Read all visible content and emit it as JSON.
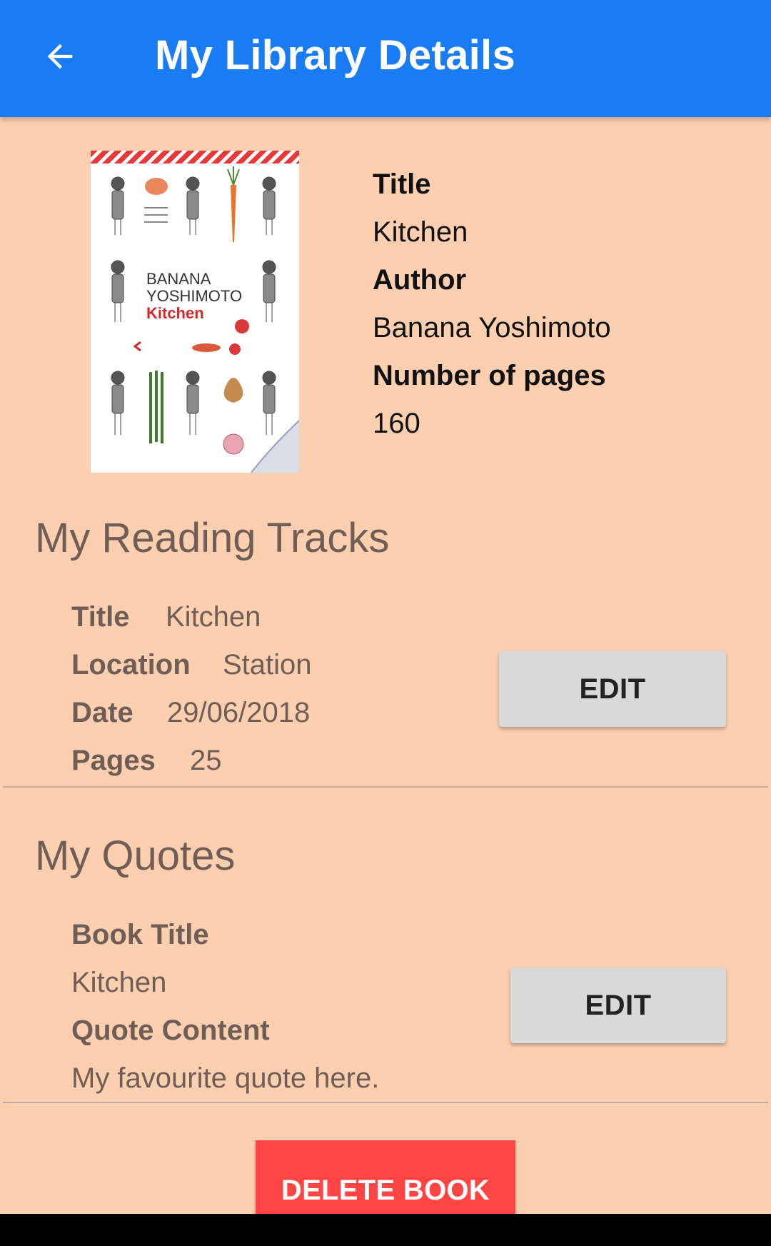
{
  "appbar": {
    "title": "My Library Details",
    "back_icon": "arrow-left-icon",
    "color": "#1A7CF5"
  },
  "book": {
    "cover": {
      "author_text": "BANANA YOSHIMOTO",
      "title_text": "Kitchen"
    },
    "title_label": "Title",
    "title": "Kitchen",
    "author_label": "Author",
    "author": "Banana Yoshimoto",
    "pages_label": "Number of pages",
    "pages": "160"
  },
  "reading_tracks": {
    "heading": "My Reading Tracks",
    "title_label": "Title",
    "title": "Kitchen",
    "location_label": "Location",
    "location": "Station",
    "date_label": "Date",
    "date": "29/06/2018",
    "pages_label": "Pages",
    "pages": "25",
    "edit_label": "EDIT"
  },
  "quotes": {
    "heading": "My Quotes",
    "book_title_label": "Book Title",
    "book_title": "Kitchen",
    "content_label": "Quote Content",
    "content": "My favourite quote here.",
    "edit_label": "EDIT"
  },
  "delete_label": "DELETE BOOK",
  "colors": {
    "background": "#FDCFB1",
    "delete": "#FF4444",
    "edit_button": "#D9D9D9"
  }
}
